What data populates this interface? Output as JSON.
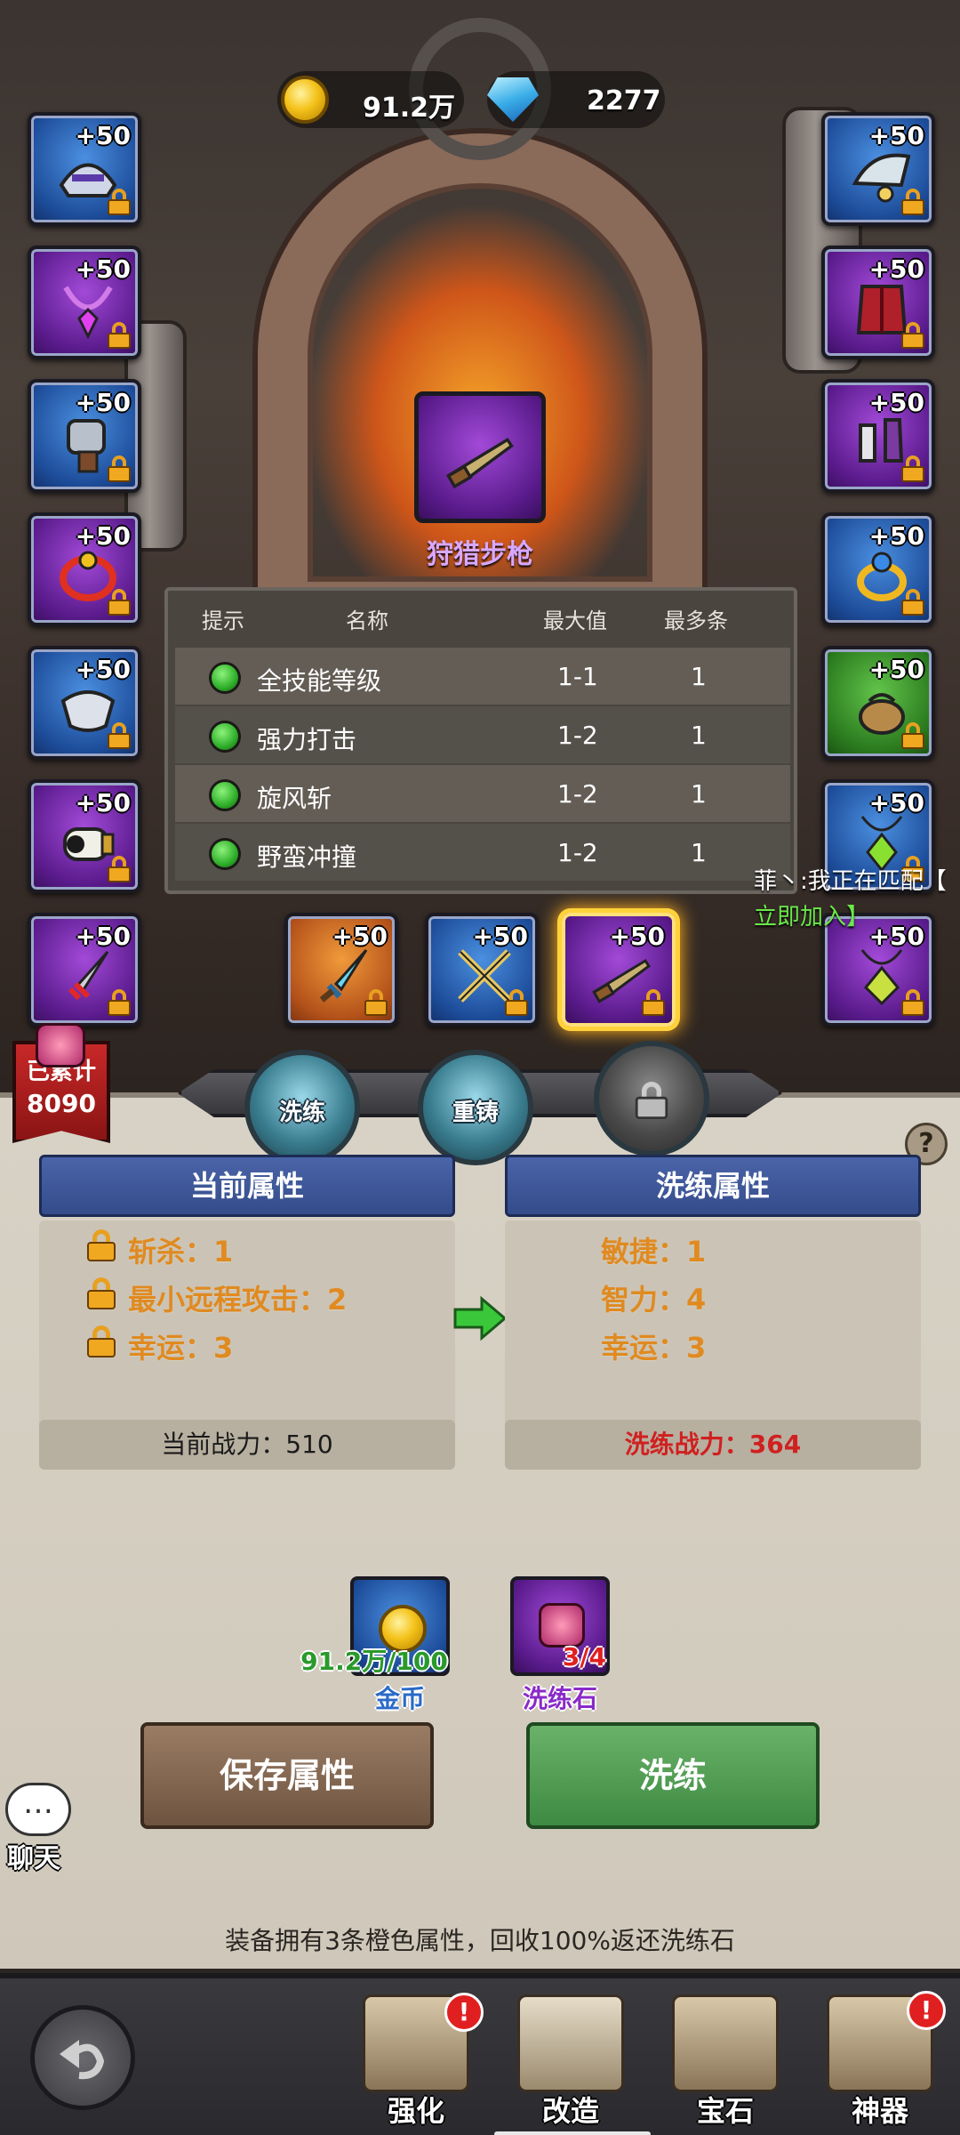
{
  "currency": {
    "gold": "91.2万",
    "gems": "2277"
  },
  "slots": [
    {
      "level": "+50",
      "quality": "blue",
      "icon": "helmet-icon"
    },
    {
      "level": "+50",
      "quality": "purple",
      "icon": "necklace-icon"
    },
    {
      "level": "+50",
      "quality": "blue",
      "icon": "gauntlet-icon"
    },
    {
      "level": "+50",
      "quality": "purple",
      "icon": "belt-icon"
    },
    {
      "level": "+50",
      "quality": "blue",
      "icon": "bracer-icon"
    },
    {
      "level": "+50",
      "quality": "purple",
      "icon": "cannon-icon"
    },
    {
      "level": "+50",
      "quality": "purple",
      "icon": "dagger-icon"
    },
    {
      "level": "+50",
      "quality": "blue",
      "icon": "shoulder-icon"
    },
    {
      "level": "+50",
      "quality": "purple",
      "icon": "chest-armor-icon"
    },
    {
      "level": "+50",
      "quality": "purple",
      "icon": "boots-icon"
    },
    {
      "level": "+50",
      "quality": "blue",
      "icon": "ring-icon"
    },
    {
      "level": "+50",
      "quality": "green",
      "icon": "pouch-icon"
    },
    {
      "level": "+50",
      "quality": "blue",
      "icon": "amulet-icon"
    },
    {
      "level": "+50",
      "quality": "purple",
      "icon": "leaf-amulet-icon"
    },
    {
      "level": "+50",
      "quality": "orange",
      "icon": "sword-icon"
    },
    {
      "level": "+50",
      "quality": "blue",
      "icon": "crossed-swords-icon"
    },
    {
      "level": "+50",
      "quality": "purple",
      "icon": "rifle-icon"
    }
  ],
  "selected_item": {
    "name": "狩猎步枪"
  },
  "attr_table": {
    "headers": [
      "提示",
      "名称",
      "最大值",
      "最多条"
    ],
    "rows": [
      {
        "name": "全技能等级",
        "max": "1-1",
        "count": "1"
      },
      {
        "name": "强力打击",
        "max": "1-2",
        "count": "1"
      },
      {
        "name": "旋风斩",
        "max": "1-2",
        "count": "1"
      },
      {
        "name": "野蛮冲撞",
        "max": "1-2",
        "count": "1"
      }
    ]
  },
  "chat_overlay": {
    "line1": "菲丶:我正在匹配【",
    "line2": "立即加入】"
  },
  "accumulated": {
    "label": "已累计",
    "value": "8090"
  },
  "tabs": [
    {
      "label": "洗练",
      "active": true
    },
    {
      "label": "重铸",
      "active": false
    },
    {
      "label": "",
      "locked": true
    }
  ],
  "help": "?",
  "current_attrs": {
    "title": "当前属性",
    "lines": [
      "斩杀：1",
      "最小远程攻击：2",
      "幸运：3"
    ],
    "power": "当前战力：510"
  },
  "refined_attrs": {
    "title": "洗练属性",
    "lines": [
      "敏捷：1",
      "智力：4",
      "幸运：3"
    ],
    "power": "洗练战力：364"
  },
  "costs": [
    {
      "amount": "91.2万/100",
      "label": "金币",
      "color": "#2a9a2a",
      "label_color": "#2a6ac8"
    },
    {
      "amount": "3/4",
      "label": "洗练石",
      "color": "#e02020",
      "label_color": "#8a2ac8"
    }
  ],
  "buttons": {
    "save": "保存属性",
    "refine": "洗练"
  },
  "chat_button": {
    "label": "聊天",
    "icon": "…"
  },
  "footer_note": "装备拥有3条橙色属性，回收100%返还洗练石",
  "nav": [
    {
      "label": "强化",
      "badge": "!"
    },
    {
      "label": "改造",
      "badge": ""
    },
    {
      "label": "宝石",
      "badge": ""
    },
    {
      "label": "神器",
      "badge": "!"
    }
  ],
  "colors": {
    "accent_gold": "#e08a20",
    "power_red": "#d02020",
    "selected_frame": "#ffd23a"
  }
}
